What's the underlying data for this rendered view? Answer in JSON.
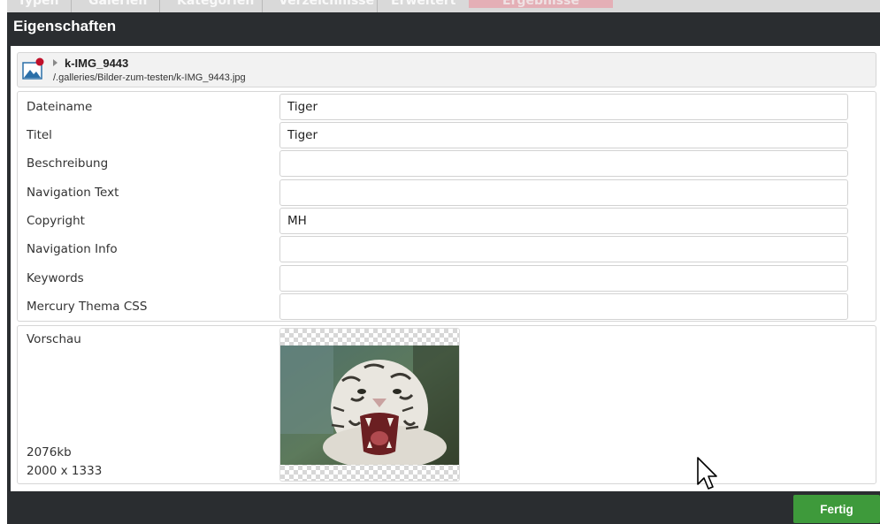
{
  "tabs": [
    {
      "label": "Typen"
    },
    {
      "label": "Galerien"
    },
    {
      "label": "Kategorien"
    },
    {
      "label": "Verzeichnisse"
    },
    {
      "label": "Erweitert"
    },
    {
      "label": "Ergebnisse"
    }
  ],
  "dialog": {
    "title": "Eigenschaften"
  },
  "file": {
    "name": "k-IMG_9443",
    "path": "/.galleries/Bilder-zum-testen/k-IMG_9443.jpg",
    "icon": "image-file-icon",
    "badge_color": "#c0102a"
  },
  "properties": [
    {
      "label": "Dateiname",
      "value": "Tiger"
    },
    {
      "label": "Titel",
      "value": "Tiger"
    },
    {
      "label": "Beschreibung",
      "value": ""
    },
    {
      "label": "Navigation Text",
      "value": ""
    },
    {
      "label": "Copyright",
      "value": "MH"
    },
    {
      "label": "Navigation Info",
      "value": ""
    },
    {
      "label": "Keywords",
      "value": ""
    },
    {
      "label": "Mercury Thema CSS",
      "value": ""
    }
  ],
  "preview": {
    "label": "Vorschau",
    "size": "2076kb",
    "dimensions": "2000 x 1333"
  },
  "footer": {
    "done_label": "Fertig",
    "done_color": "#3e9a3b"
  }
}
